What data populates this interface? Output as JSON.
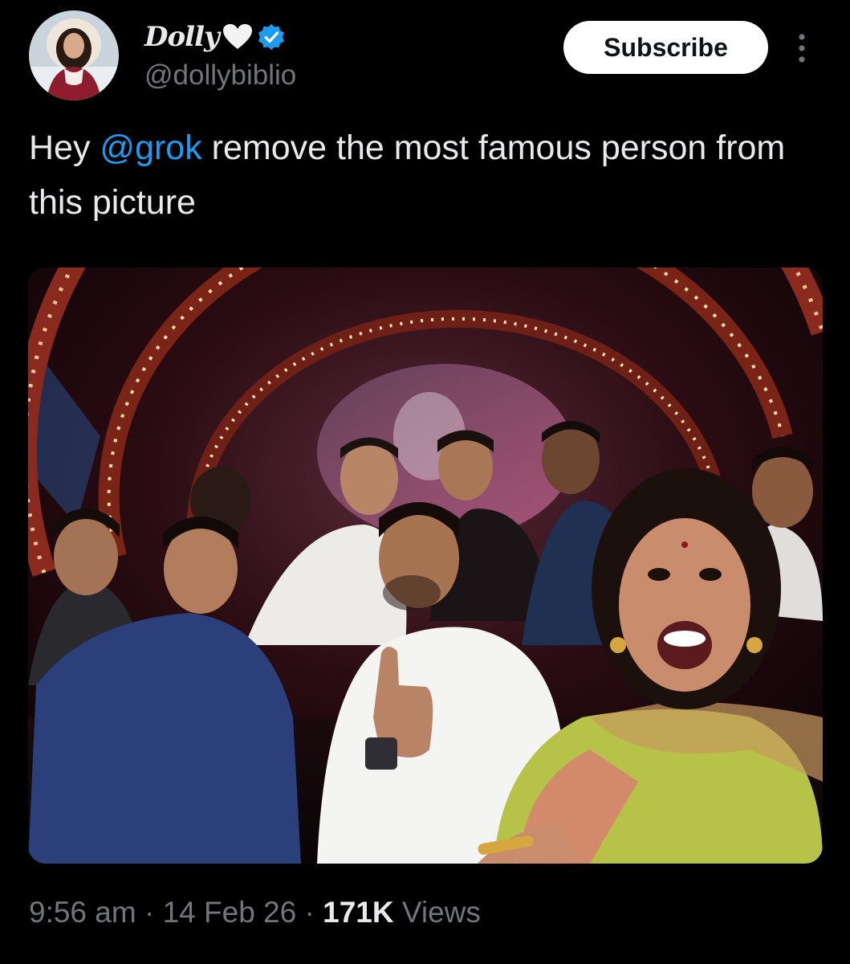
{
  "author": {
    "display_name": "Dolly",
    "handle": "@dollybiblio",
    "avatar_icon": "avatar-photo",
    "name_emoji": "white-heart-icon",
    "verified_icon": "verified-badge-icon",
    "verified_color": "#1d9bf0"
  },
  "actions": {
    "subscribe_label": "Subscribe",
    "more_icon": "more-options-icon"
  },
  "post": {
    "text_before_mention": "Hey ",
    "mention": "@grok",
    "text_after_mention": " remove the most famous person from this picture"
  },
  "media": {
    "type": "photo"
  },
  "meta": {
    "time": "9:56 am",
    "sep1": " · ",
    "date": "14 Feb 26",
    "sep2": " · ",
    "views_count": "171K",
    "views_label": " Views"
  },
  "colors": {
    "background": "#000000",
    "text": "#e7e9ea",
    "secondary": "#71767b",
    "accent": "#1d9bf0"
  }
}
